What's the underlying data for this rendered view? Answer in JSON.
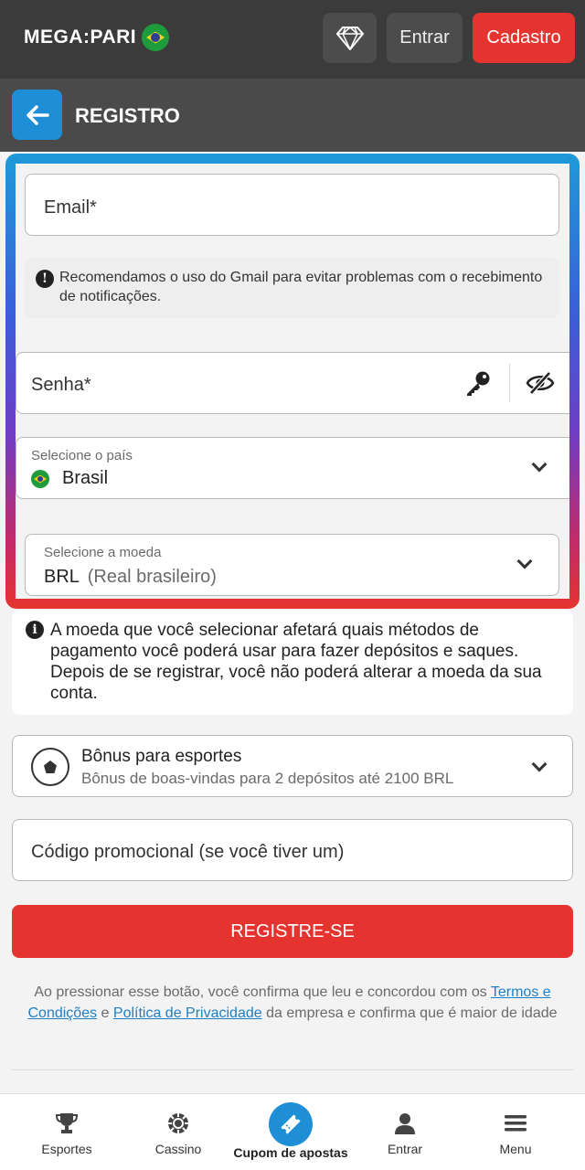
{
  "topbar": {
    "logo_text": "MEGA:PARI",
    "entrar_label": "Entrar",
    "cadastro_label": "Cadastro",
    "diamond_icon": "diamond-icon"
  },
  "header": {
    "title": "REGISTRO",
    "back_icon": "arrow-left-icon"
  },
  "form": {
    "email_placeholder": "Email*",
    "gmail_notice": "Recomendamos o uso do Gmail para evitar problemas com o recebimento de notificações.",
    "password_placeholder": "Senha*",
    "country_label": "Selecione o país",
    "country_value": "Brasil",
    "currency_label": "Selecione a moeda",
    "currency_code": "BRL",
    "currency_name": "(Real brasileiro)",
    "currency_notice": "A moeda que você selecionar afetará quais métodos de pagamento você poderá usar para fazer depósitos e saques. Depois de se registrar, você não poderá alterar a moeda da sua conta.",
    "bonus_title": "Bônus para esportes",
    "bonus_subtitle": "Bônus de boas-vindas para 2 depósitos até 2100 BRL",
    "promo_placeholder": "Código promocional (se você tiver um)",
    "register_label": "REGISTRE-SE"
  },
  "terms": {
    "part1": "Ao pressionar esse botão, você confirma que leu e concordou com os ",
    "link_terms": "Termos e Condições",
    "part2": " e ",
    "link_privacy": "Política de Privacidade",
    "part3": " da empresa e confirma que é maior de idade"
  },
  "bottom_nav": {
    "items": [
      {
        "label": "Esportes",
        "icon": "trophy-icon"
      },
      {
        "label": "Cassino",
        "icon": "casino-chip-icon"
      },
      {
        "label": "Cupom de apostas",
        "icon": "ticket-icon"
      },
      {
        "label": "Entrar",
        "icon": "user-icon"
      },
      {
        "label": "Menu",
        "icon": "hamburger-icon"
      }
    ]
  },
  "colors": {
    "accent_red": "#e53430",
    "accent_blue": "#1e8fd6",
    "topbar_bg": "#3b3b3b"
  }
}
